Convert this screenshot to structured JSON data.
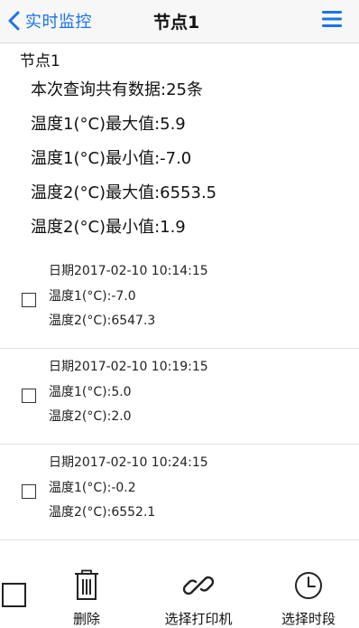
{
  "header": {
    "back_label": "实时监控",
    "title": "节点1",
    "back_icon": "chevron-left-icon",
    "menu_icon": "hamburger-menu-icon",
    "accent_color": "#1a73e8"
  },
  "summary": {
    "heading": "节点1",
    "lines": [
      "本次查询共有数据:25条",
      "温度1(°C)最大值:5.9",
      "温度1(°C)最小值:-7.0",
      "温度2(°C)最大值:6553.5",
      "温度2(°C)最小值:1.9"
    ]
  },
  "records": [
    {
      "date": "日期2017-02-10 10:14:15",
      "temp1": "温度1(°C):-7.0",
      "temp2": "温度2(°C):6547.3"
    },
    {
      "date": "日期2017-02-10 10:19:15",
      "temp1": "温度1(°C):5.0",
      "temp2": "温度2(°C):2.0"
    },
    {
      "date": "日期2017-02-10 10:24:15",
      "temp1": "温度1(°C):-0.2",
      "temp2": "温度2(°C):6552.1"
    }
  ],
  "toolbar": {
    "delete_label": "删除",
    "delete_icon": "trash-icon",
    "printer_label": "选择打印机",
    "printer_icon": "link-icon",
    "period_label": "选择时段",
    "period_icon": "clock-icon"
  }
}
